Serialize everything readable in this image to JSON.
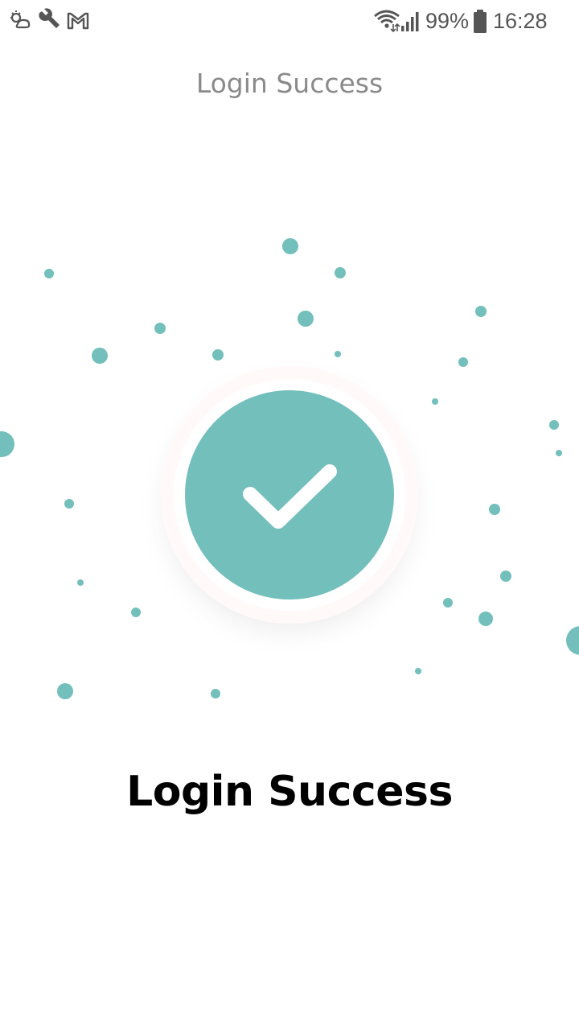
{
  "status_bar": {
    "battery_percent": "99%",
    "time": "16:28"
  },
  "header": {
    "title": "Login Success"
  },
  "main": {
    "message": "Login Success",
    "accent_color": "#72bfbc"
  }
}
